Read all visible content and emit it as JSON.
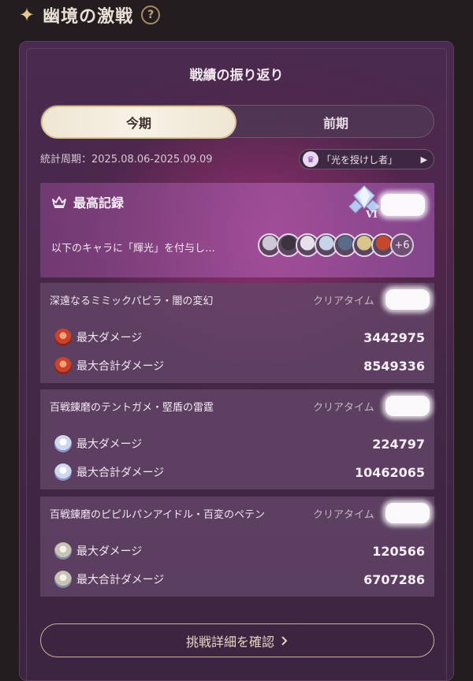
{
  "header": {
    "title": "幽境の激戦",
    "help": "?"
  },
  "card": {
    "title": "戦績の振り返り"
  },
  "tabs": [
    {
      "label": "今期",
      "active": true
    },
    {
      "label": "前期",
      "active": false
    }
  ],
  "period": "統計周期：2025.08.06-2025.09.09",
  "badge": {
    "label": "「光を授けし者」"
  },
  "best": {
    "title": "最高記録",
    "rank": "VI",
    "text": "以下のキャラに「輝光」を付与し…",
    "more": "+6",
    "avatars": [
      "#cfc7d6",
      "#3b3340",
      "#e6e0ea",
      "#c7d3e8",
      "#5a6b8a",
      "#d9c48a",
      "#c4472e"
    ]
  },
  "dungeons": [
    {
      "name": "深遠なるミミックパピラ・闇の変幻",
      "clear": "クリアタイム",
      "icon": "fire",
      "rows": [
        {
          "label": "最大ダメージ",
          "value": "3442975"
        },
        {
          "label": "最大合計ダメージ",
          "value": "8549336"
        }
      ]
    },
    {
      "name": "百戦錬磨のテントガメ・堅盾の雷霆",
      "clear": "クリアタイム",
      "icon": "ice",
      "rows": [
        {
          "label": "最大ダメージ",
          "value": "224797"
        },
        {
          "label": "最大合計ダメージ",
          "value": "10462065"
        }
      ]
    },
    {
      "name": "百戦錬磨のピピルパンアイドル・百変のペテン",
      "clear": "クリアタイム",
      "icon": "silver",
      "rows": [
        {
          "label": "最大ダメージ",
          "value": "120566"
        },
        {
          "label": "最大合計ダメージ",
          "value": "6707286"
        }
      ]
    }
  ],
  "confirm": {
    "label": "挑戦詳細を確認"
  },
  "colors": {
    "accent": "#e6c78f",
    "card_bg": "#452848",
    "panel": "#644669"
  }
}
